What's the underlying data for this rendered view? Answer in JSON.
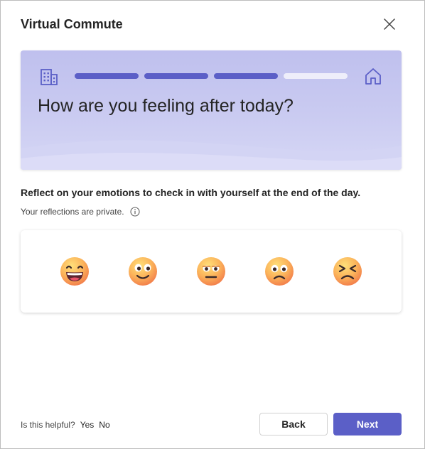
{
  "dialog": {
    "title": "Virtual Commute",
    "close_icon": "close-icon"
  },
  "hero": {
    "question": "How are you feeling after today?",
    "start_icon": "building-icon",
    "end_icon": "home-icon",
    "progress": {
      "total_steps": 4,
      "completed_steps": 3
    },
    "colors": {
      "accent": "#5b5fc7",
      "track": "#eeeefa",
      "background": "#c8c9f0"
    }
  },
  "prompt": "Reflect on your emotions to check in with yourself at the end of the day.",
  "privacy": {
    "text": "Your reflections are private.",
    "info_icon": "info-icon"
  },
  "emojis": [
    {
      "icon": "grinning-face-icon"
    },
    {
      "icon": "smiling-face-icon"
    },
    {
      "icon": "neutral-face-icon"
    },
    {
      "icon": "frowning-face-icon"
    },
    {
      "icon": "persevering-face-icon"
    }
  ],
  "footer": {
    "helpful_question": "Is this helpful?",
    "yes_label": "Yes",
    "no_label": "No",
    "back_label": "Back",
    "next_label": "Next"
  }
}
